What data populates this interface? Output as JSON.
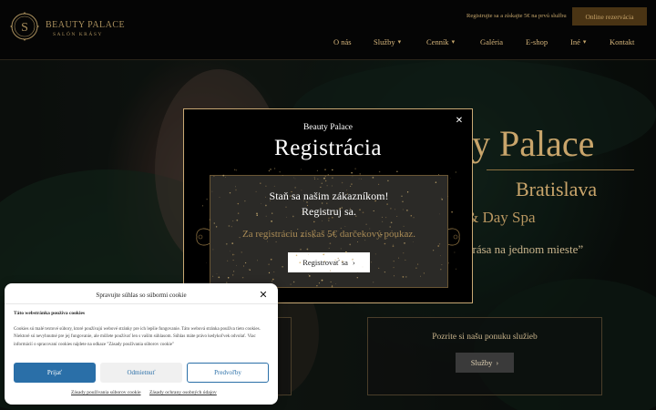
{
  "header": {
    "logo_name": "BEAUTY PALACE",
    "logo_tag": "SALÓN KRÁSY",
    "promo_text": "Registrujte sa a získajte 5€ na prvú službu",
    "cta_label": "Online rezervácia",
    "nav": [
      {
        "label": "O nás",
        "has_dropdown": false
      },
      {
        "label": "Služby",
        "has_dropdown": true
      },
      {
        "label": "Cenník",
        "has_dropdown": true
      },
      {
        "label": "Galéria",
        "has_dropdown": false
      },
      {
        "label": "E-shop",
        "has_dropdown": false
      },
      {
        "label": "Iné",
        "has_dropdown": true
      },
      {
        "label": "Kontakt",
        "has_dropdown": false
      }
    ]
  },
  "hero": {
    "title_fragment": "y Palace",
    "city": "Bratislava",
    "spa_fragment": "& Day Spa",
    "quote_fragment": "krása na jednom mieste”",
    "services_text": "Pozrite si našu ponuku služieb",
    "services_button": "Služby"
  },
  "modal": {
    "kicker": "Beauty Palace",
    "title": "Registrácia",
    "line1": "Staň sa našim zákazníkom!",
    "line2": "Registruj sa.",
    "gift": "Za registráciu získaš 5€ darčekový poukaz.",
    "button": "Registrovať sa"
  },
  "cookie": {
    "title": "Spravujte súhlas so súbormi cookie",
    "subtitle": "Táto webstránka používa cookies",
    "body": "Cookies sú malé textové súbory, ktoré používajú webové stránky pre ich lepšie fungovanie. Táto webová stránka používa tieto cookies. Niektoré sú nevyhnutné pre jej fungovanie, ale môžete používať len s vaším súhlasom. Súhlas máte právo kedykoľvek odvolať. Viac informácií o spracovaní cookies nájdete na odkaze \"Zásady používania súborov cookie\"",
    "accept": "Prijať",
    "deny": "Odmietnuť",
    "preferences": "Predvoľby",
    "link1": "Zásady používania súborov cookie",
    "link2": "Zásady ochrany osobných údajov"
  },
  "colors": {
    "gold": "#c9a56b",
    "modal_border": "#c8a874",
    "cookie_accent": "#2a6fa8"
  }
}
